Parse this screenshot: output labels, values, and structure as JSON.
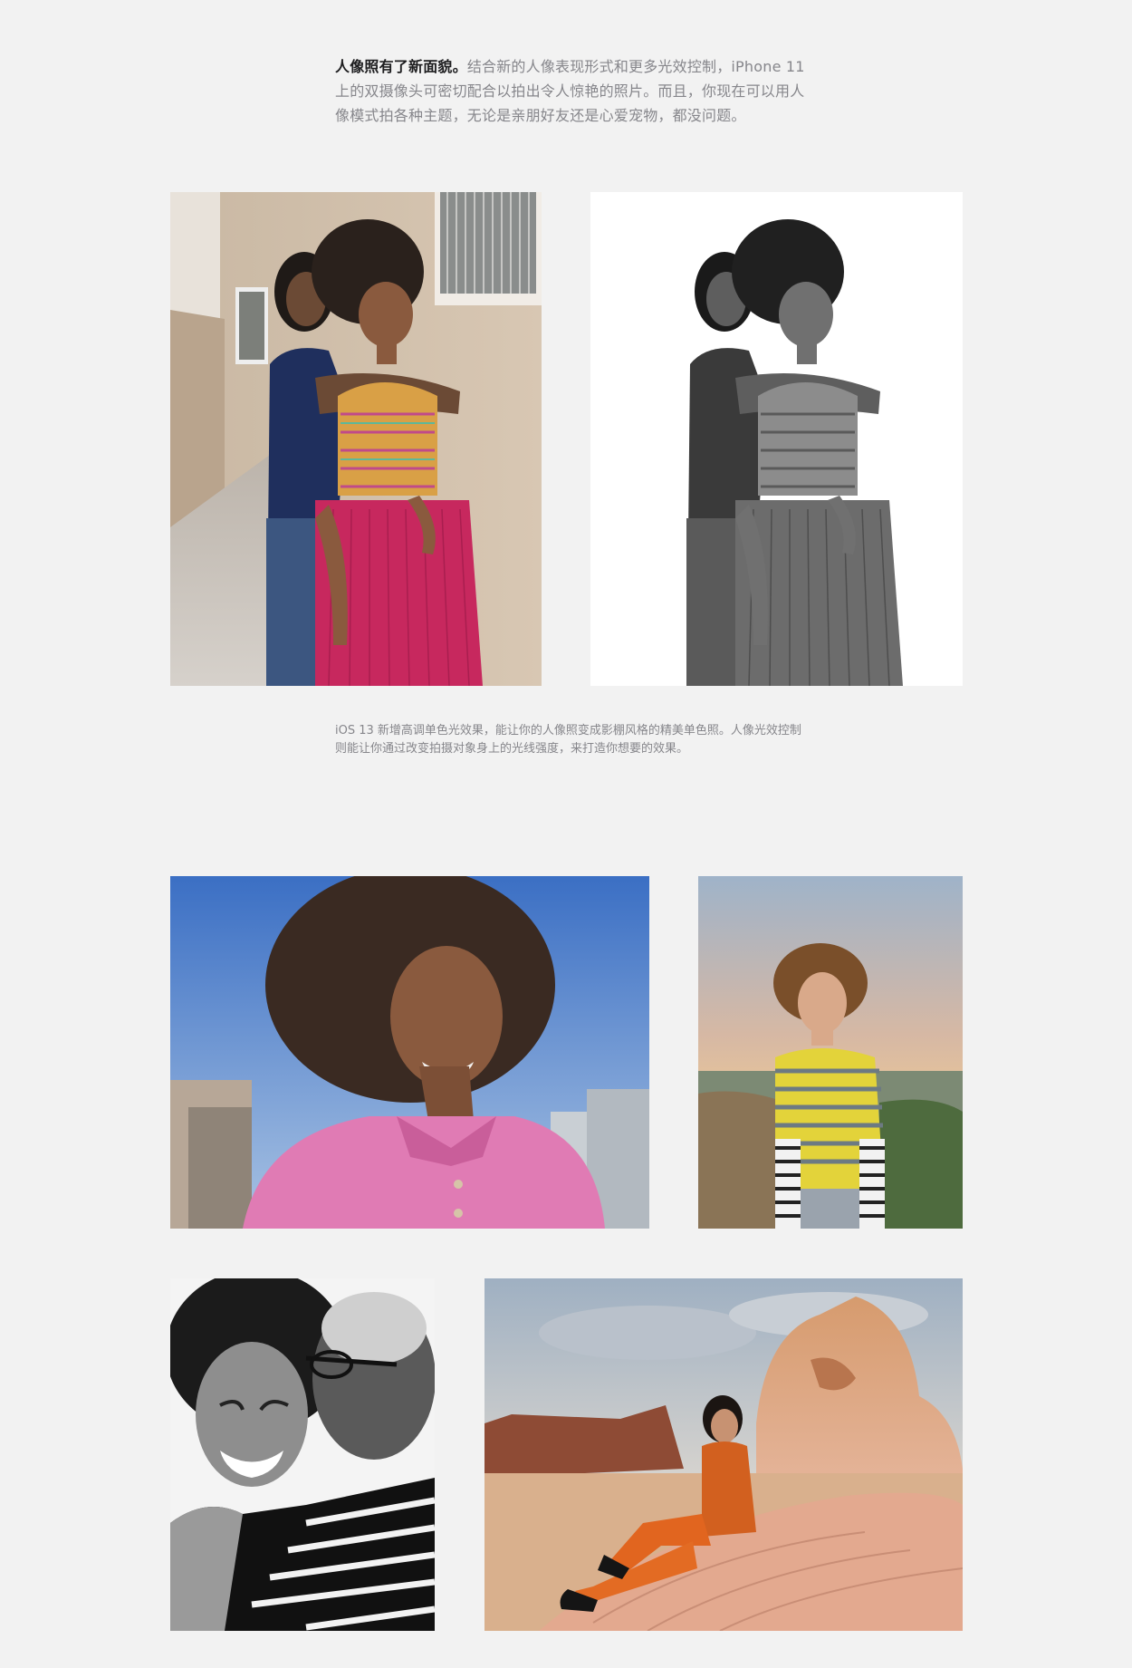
{
  "intro": {
    "lead": "人像照有了新面貌。",
    "body": "结合新的人像表现形式和更多光效控制，iPhone 11 上的双摄像头可密切配合以拍出令人惊艳的照片。而且，你现在可以用人像模式拍各种主题，无论是亲朋好友还是心爱宠物，都没问题。"
  },
  "caption": "iOS 13 新增高调单色光效果，能让你的人像照变成影棚风格的精美单色照。人像光效控制则能让你通过改变拍摄对象身上的光线强度，来打造你想要的效果。",
  "photos": [
    {
      "name": "couple-street-color-photo",
      "style": "color"
    },
    {
      "name": "couple-high-key-mono-photo",
      "style": "high-key-mono"
    },
    {
      "name": "woman-pink-shirt-city-photo",
      "style": "color"
    },
    {
      "name": "man-yellow-sweater-sunset-photo",
      "style": "color"
    },
    {
      "name": "grandparent-kiss-mono-photo",
      "style": "mono"
    },
    {
      "name": "woman-desert-rocks-photo",
      "style": "color"
    }
  ]
}
